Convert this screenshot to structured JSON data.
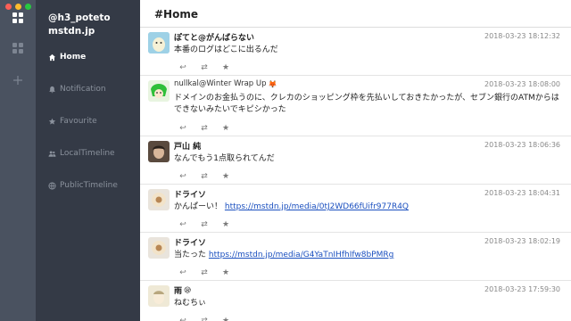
{
  "account": {
    "handle": "@h3_poteto",
    "instance": "mstdn.jp"
  },
  "nav": [
    {
      "label": "Home",
      "icon": "home-icon",
      "active": true
    },
    {
      "label": "Notification",
      "icon": "bell-icon",
      "active": false
    },
    {
      "label": "Favourite",
      "icon": "star-icon",
      "active": false
    },
    {
      "label": "LocalTimeline",
      "icon": "users-icon",
      "active": false
    },
    {
      "label": "PublicTimeline",
      "icon": "globe-icon",
      "active": false
    }
  ],
  "timeline": {
    "title": "#Home",
    "statuses": [
      {
        "name": "ぽてと@がんばらない",
        "time": "2018-03-23 18:12:32",
        "text": "本番のログはどこに出るんだ",
        "link": ""
      },
      {
        "name": "nullkal@Winter Wrap Up",
        "time": "2018-03-23 18:08:00",
        "text": "ドメインのお金払うのに、クレカのショッピング枠を先払いしておきたかったが、セブン銀行のATMからはできないみたいでキピシかった",
        "link": ""
      },
      {
        "name": "戸山 純",
        "time": "2018-03-23 18:06:36",
        "text": "なんでもう1点取られてんだ",
        "link": ""
      },
      {
        "name": "ドライソ",
        "time": "2018-03-23 18:04:31",
        "text": "かんぱーい！",
        "link": "https://mstdn.jp/media/0tJ2WD66fUifr977R4Q"
      },
      {
        "name": "ドライソ",
        "time": "2018-03-23 18:02:19",
        "text": "当たった",
        "link": "https://mstdn.jp/media/G4YaTnIHfhIfw8bPMRg"
      },
      {
        "name": "雨",
        "time": "2018-03-23 17:59:30",
        "text": "ねむちぃ",
        "link": ""
      }
    ]
  },
  "colors": {
    "rail": "#4a5260",
    "sidebar": "#343a46",
    "link": "#1a4fbf"
  }
}
